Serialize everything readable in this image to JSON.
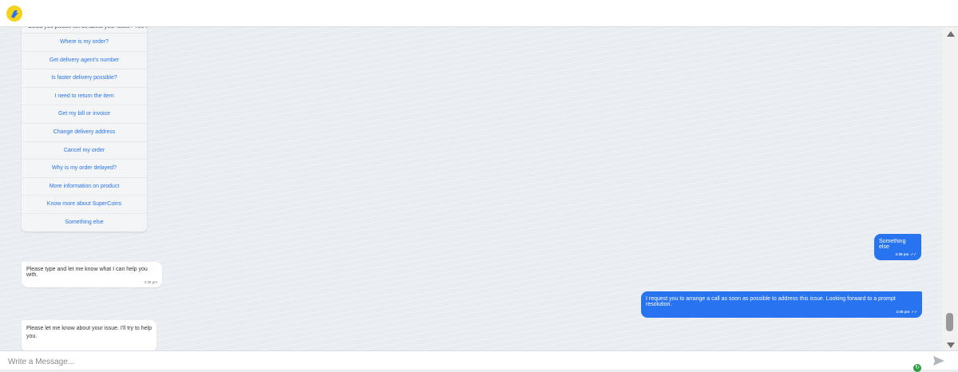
{
  "header": {
    "logo_icon": "flipkart-logo-icon"
  },
  "menu": {
    "intro_text": "Could you please tell us about your issue? You can select from the options below or type your query...",
    "items": [
      "Where is my order?",
      "Get delivery agent's number",
      "Is faster delivery possible?",
      "I need to return the item",
      "Get my bill or invoice",
      "Change delivery address",
      "Cancel my order",
      "Why is my order delayed?",
      "More information on product",
      "Know more about SuperCoins",
      "Something else"
    ]
  },
  "messages": {
    "user1": {
      "text": "Something else",
      "time": "2:35 pm",
      "tick": "✓✓"
    },
    "bot1": {
      "text": "Please type and let me know what I can help you with.",
      "time": "2:35 pm"
    },
    "user2": {
      "text": "I request you to arrange a call as soon as possible to address this issue. Looking forward to a prompt resolution.",
      "time": "2:35 pm",
      "tick": "✓✓"
    },
    "bot2": {
      "text": "Please let me know about your issue. I'll try to help you."
    }
  },
  "composer": {
    "placeholder": "Write a Message...",
    "send_icon": "send-icon",
    "status_icon": "online-status-icon"
  },
  "colors": {
    "accent": "#2874f0",
    "background": "#e9edf2"
  }
}
